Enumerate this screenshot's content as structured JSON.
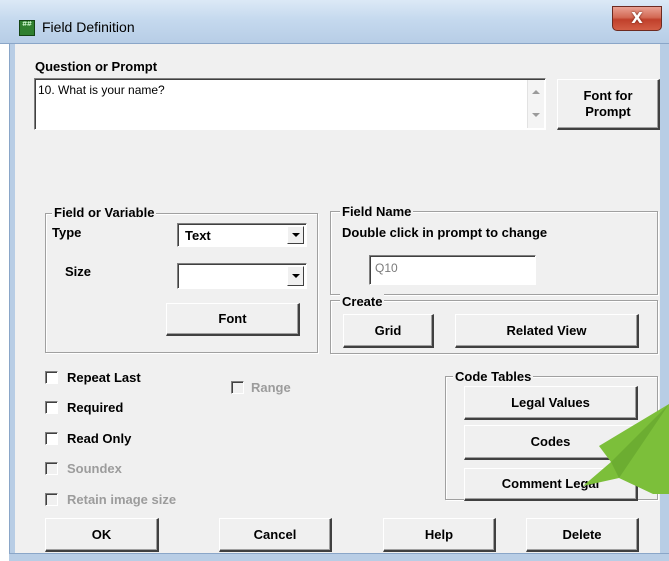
{
  "window": {
    "title": "Field Definition",
    "close_glyph": "X",
    "icon": "field-definition-app-icon",
    "icon_text": "##"
  },
  "prompt": {
    "label": "Question or Prompt",
    "value": "10. What is your name?",
    "font_button": "Font for Prompt"
  },
  "field_var": {
    "title": "Field or Variable",
    "type_label": "Type",
    "type_value": "Text",
    "size_label": "Size",
    "size_value": "",
    "font_button": "Font"
  },
  "field_name": {
    "title": "Field Name",
    "hint": "Double click in prompt to change",
    "value": "Q10"
  },
  "create": {
    "title": "Create",
    "grid_button": "Grid",
    "related_view_button": "Related View"
  },
  "options": {
    "repeat_last": "Repeat Last",
    "required": "Required",
    "read_only": "Read Only",
    "soundex": "Soundex",
    "retain_image_size": "Retain image size",
    "range": "Range"
  },
  "code_tables": {
    "title": "Code Tables",
    "legal_values_button": "Legal Values",
    "codes_button": "Codes",
    "comment_legal_button": "Comment Legal"
  },
  "footer": {
    "ok": "OK",
    "cancel": "Cancel",
    "help": "Help",
    "delete": "Delete"
  },
  "colors": {
    "dialog_bg": "#f0f0f0",
    "titlebar": "#c5d9ee",
    "close_button": "#c7513c",
    "annotation_arrow": "#7cbf3a"
  }
}
